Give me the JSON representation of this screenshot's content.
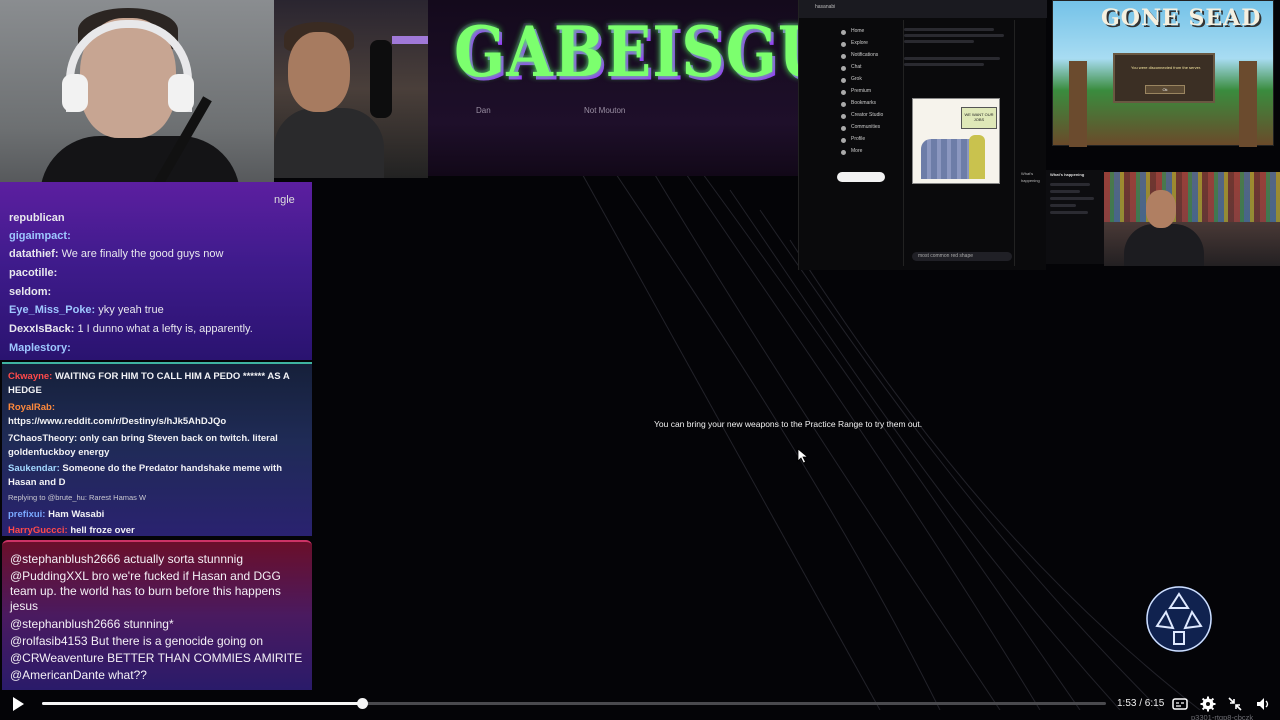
{
  "banner": {
    "logo_text": "GABEISGUNK",
    "sub_left": "Dan",
    "sub_right": "Not Mouton"
  },
  "chat_top": {
    "overflow_tag": "ngle",
    "lines": [
      {
        "name": "republican",
        "message": "",
        "color": "#e8e8ee"
      },
      {
        "name": "gigaimpact:",
        "message": "",
        "color": "#9ec7ff"
      },
      {
        "name": "datathief:",
        "message": "We are finally the good guys now",
        "color": "#e8e8ee"
      },
      {
        "name": "pacotille:",
        "message": "",
        "color": "#e8e8ee"
      },
      {
        "name": "seldom:",
        "message": "",
        "color": "#e8e8ee"
      },
      {
        "name": "Eye_Miss_Poke:",
        "message": "yky  yeah true",
        "color": "#9ec7ff"
      },
      {
        "name": "DexxIsBack:",
        "message": "1 I dunno what a lefty is, apparently.",
        "color": "#e8e8ee"
      },
      {
        "name": "Maplestory:",
        "message": "",
        "color": "#9ec7ff"
      }
    ]
  },
  "chat_mid": {
    "lines": [
      {
        "name": "Ckwayne:",
        "message": "WAITING FOR HIM TO CALL HIM A PEDO ****** AS A",
        "name_color": "#ff4a4a"
      },
      {
        "name": "",
        "message": "HEDGE",
        "name_color": "#ffffff"
      },
      {
        "name": "RoyalRab:",
        "message": "",
        "name_color": "#ff8a3c"
      },
      {
        "name": "",
        "message": "https://www.reddit.com/r/Destiny/s/hJk5AhDJQo",
        "name_color": "#ffffff"
      },
      {
        "name": "7ChaosTheory:",
        "message": "only  can bring Steven back on twitch. literal",
        "name_color": "#ffffff"
      },
      {
        "name": "",
        "message": "goldenfuckboy energy",
        "name_color": "#ffffff"
      },
      {
        "name": "Saukendar:",
        "message": "Someone do the Predator handshake meme with",
        "name_color": "#a3d9ff"
      },
      {
        "name": "",
        "message": "Hasan and D",
        "name_color": "#ffffff"
      },
      {
        "name": "",
        "message": "Replying to @brute_hu: Rarest Hamas W",
        "name_color": "#bbbbbb"
      },
      {
        "name": "prefixui:",
        "message": "Ham Wasabi",
        "name_color": "#7aa8ff"
      },
      {
        "name": "HarryGuccci:",
        "message": "hell froze over",
        "name_color": "#ff4a4a"
      }
    ]
  },
  "chat_bottom": {
    "lines": [
      "@stephanblush2666 actually sorta stunnnig",
      "@PuddingXXL bro we're fucked if Hasan and DGG team up. the world has to burn before this happens jesus",
      "@stephanblush2666 stunning*",
      "@rolfasib4153 But there is a genocide going on",
      "@CRWeaventure BETTER THAN COMMIES AMIRITE",
      "@AmericanDante what??"
    ]
  },
  "browser": {
    "tab_title": "hasanabi",
    "sidebar_items": [
      "Home",
      "Explore",
      "Notifications",
      "Chat",
      "Grok",
      "Premium",
      "Bookmarks",
      "Creator Studio",
      "Communities",
      "Profile",
      "More"
    ],
    "meme_sign": "WE WANT OUR JOBS",
    "search_placeholder": "most common red shape",
    "right_heading": "What's happening"
  },
  "game": {
    "title": "GONE SEAD",
    "dialog_text": "You were disconnected from the server.",
    "dialog_button": "Ok"
  },
  "practice_message": "You can bring your new weapons to the Practice Range to try them out.",
  "player": {
    "time_text": "1:53 / 6:15",
    "progress": 0.301,
    "watermark": "p3301-rtgp8-cbczk"
  },
  "colors": {
    "accent_green": "#7cff6e",
    "chat_purple": "#5c1fa0",
    "progress_white": "#f5f5f5"
  },
  "icons": [
    "play-icon",
    "captions-icon",
    "settings-icon",
    "fullscreen-exit-icon",
    "volume-icon",
    "cursor-icon",
    "radiant-icon"
  ]
}
